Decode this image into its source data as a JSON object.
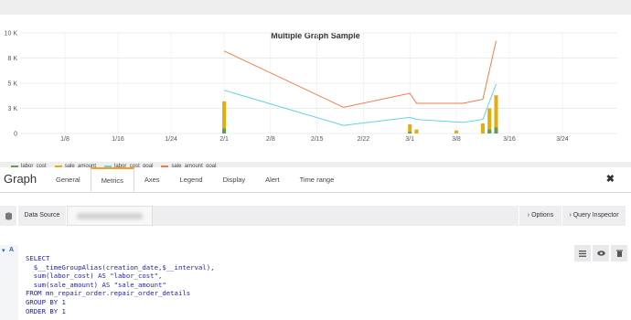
{
  "chart": {
    "title": "Multiple Graph Sample",
    "y_ticks": [
      "10 K",
      "8 K",
      "5 K",
      "3 K",
      "0"
    ],
    "x_ticks": [
      "1/8",
      "1/16",
      "1/24",
      "2/1",
      "2/8",
      "2/15",
      "2/22",
      "3/1",
      "3/8",
      "3/16",
      "3/24"
    ]
  },
  "legend": [
    {
      "label": "labor_cost",
      "color": "#629e51"
    },
    {
      "label": "sale_amount",
      "color": "#e5ac0e"
    },
    {
      "label": "labor_cost_goal",
      "color": "#64d2e4"
    },
    {
      "label": "sale_amount_goal",
      "color": "#f07b49"
    }
  ],
  "chart_data": {
    "type": "line",
    "title": "Multiple Graph Sample",
    "ylim": [
      0,
      10000
    ],
    "x_ticks": [
      "1/8",
      "1/16",
      "1/24",
      "2/1",
      "2/8",
      "2/15",
      "2/22",
      "3/1",
      "3/8",
      "3/16",
      "3/24"
    ],
    "series": [
      {
        "name": "sale_amount_goal",
        "type": "line",
        "color": "#f07b49",
        "points": [
          [
            "2/1",
            8200
          ],
          [
            "2/19",
            2600
          ],
          [
            "3/1",
            4000
          ],
          [
            "3/2",
            3000
          ],
          [
            "3/9",
            3000
          ],
          [
            "3/12",
            3400
          ],
          [
            "3/14",
            9200
          ]
        ]
      },
      {
        "name": "labor_cost_goal",
        "type": "line",
        "color": "#64d2e4",
        "points": [
          [
            "2/1",
            4300
          ],
          [
            "2/19",
            800
          ],
          [
            "3/1",
            1600
          ],
          [
            "3/2",
            1400
          ],
          [
            "3/9",
            1100
          ],
          [
            "3/12",
            1400
          ],
          [
            "3/14",
            4900
          ]
        ]
      },
      {
        "name": "sale_amount",
        "type": "bar",
        "color": "#e5ac0e",
        "points": [
          [
            "2/1",
            3200
          ],
          [
            "3/1",
            900
          ],
          [
            "3/2",
            400
          ],
          [
            "3/8",
            300
          ],
          [
            "3/12",
            1000
          ],
          [
            "3/13",
            2500
          ],
          [
            "3/14",
            3800
          ]
        ]
      },
      {
        "name": "labor_cost",
        "type": "bar",
        "color": "#629e51",
        "points": [
          [
            "2/1",
            500
          ],
          [
            "3/1",
            150
          ],
          [
            "3/13",
            400
          ],
          [
            "3/14",
            600
          ]
        ]
      }
    ]
  },
  "editor": {
    "title": "Graph",
    "tabs": [
      "General",
      "Metrics",
      "Axes",
      "Legend",
      "Display",
      "Alert",
      "Time range"
    ],
    "active_tab": "Metrics",
    "close": "✖"
  },
  "datasource": {
    "label": "Data Source",
    "options_btn": "› Options",
    "inspector_btn": "› Query Inspector"
  },
  "query": {
    "ref": "A",
    "lines": [
      "SELECT",
      "  $__timeGroupAlias(creation_date,$__interval),",
      "  sum(labor_cost) AS \"labor_cost\",",
      "  sum(sale_amount) AS \"sale_amount\"",
      "FROM mn_repair_order.repair_order_details",
      "GROUP BY 1",
      "ORDER BY 1"
    ]
  }
}
